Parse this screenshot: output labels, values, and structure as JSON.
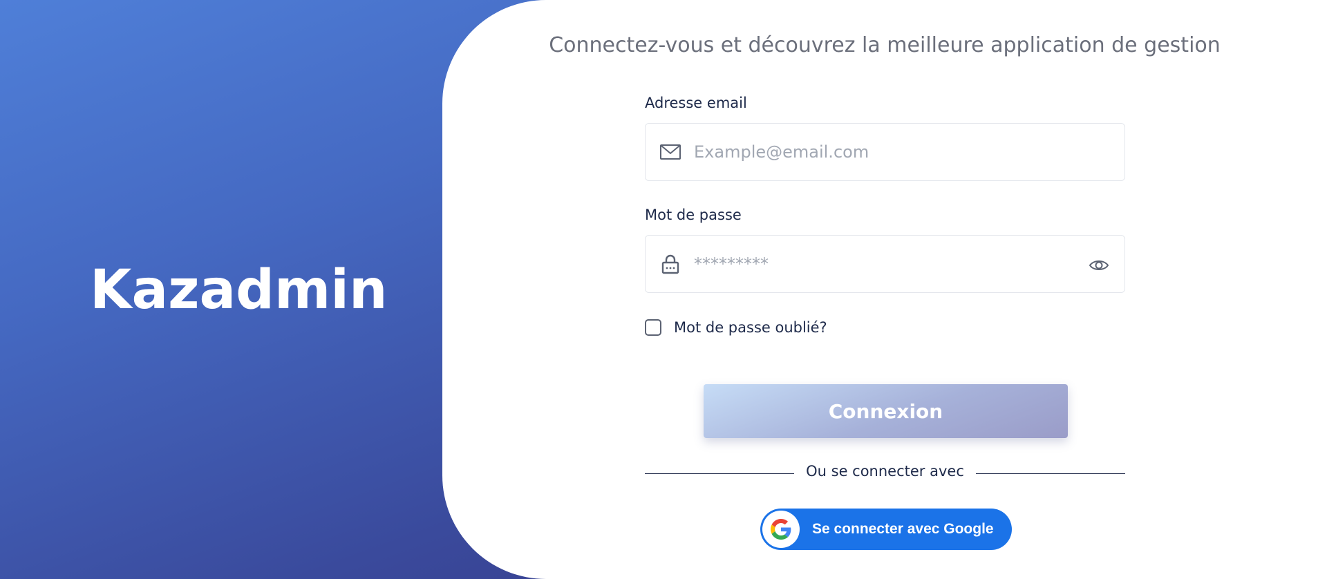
{
  "brand": {
    "name": "Kazadmin"
  },
  "tagline": "Connectez-vous et découvrez la meilleure application de gestion",
  "form": {
    "email_label": "Adresse email",
    "email_placeholder": "Example@email.com",
    "email_value": "",
    "password_label": "Mot de passe",
    "password_placeholder": "*********",
    "password_value": "",
    "remember_label": "Mot de passe oublié?",
    "remember_checked": false,
    "login_label": "Connexion",
    "divider_text": "Ou se connecter avec",
    "google_label": "Se connecter avec Google"
  },
  "icons": {
    "email": "envelope-icon",
    "password": "lock-icon",
    "toggle": "eye-icon",
    "google": "google-logo-icon"
  },
  "colors": {
    "gradient_top": "#4f7fd8",
    "gradient_bottom": "#33307e",
    "google_blue": "#1b73e8",
    "login_button": "#a6b1d9"
  }
}
